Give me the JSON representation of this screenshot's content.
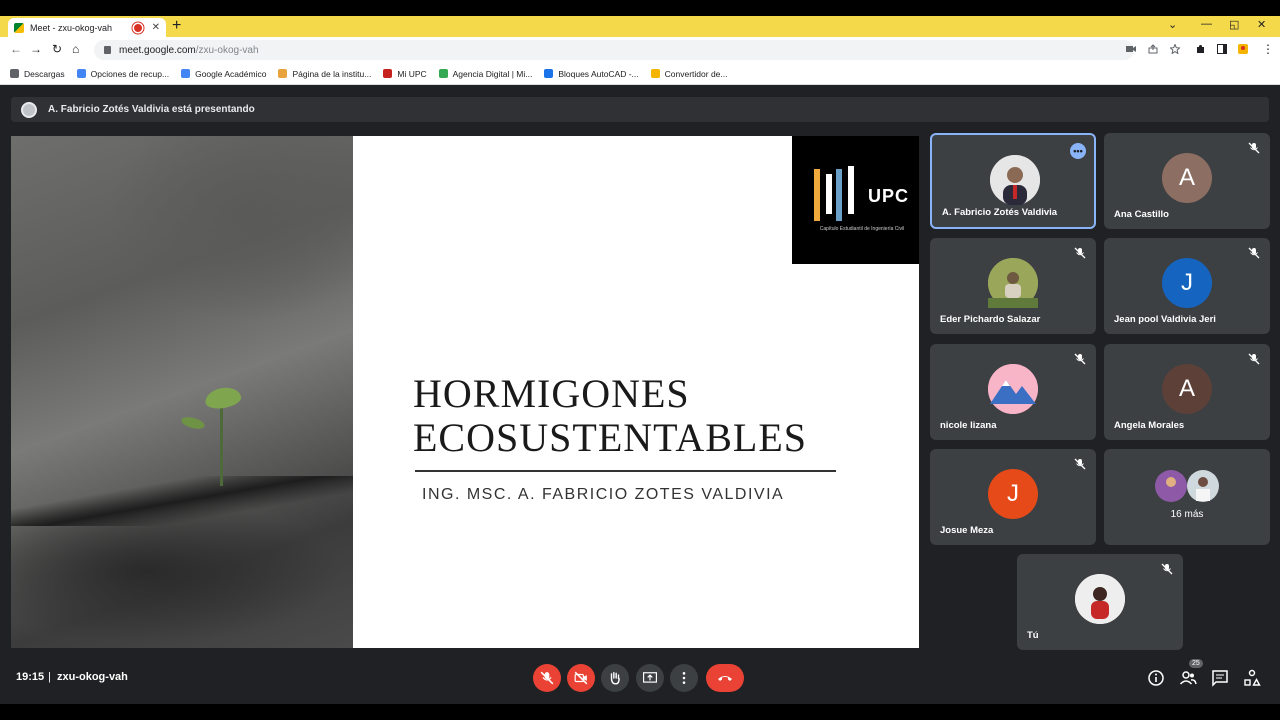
{
  "browser": {
    "tab_title": "Meet - zxu-okog-vah",
    "new_tab": "+",
    "url_host": "meet.google.com",
    "url_path": "/zxu-okog-vah",
    "bookmarks": [
      {
        "label": "Descargas",
        "icon": "download-icon",
        "color": "#5f6368"
      },
      {
        "label": "Opciones de recup...",
        "icon": "google-icon",
        "color": "#4285f4"
      },
      {
        "label": "Google Académico",
        "icon": "scholar-icon",
        "color": "#4285f4"
      },
      {
        "label": "Página de la institu...",
        "icon": "pencil-icon",
        "color": "#e8a33c"
      },
      {
        "label": "Mi UPC",
        "icon": "upc-icon",
        "color": "#c5221f"
      },
      {
        "label": "Agencia Digital | Mi...",
        "icon": "diamond-icon",
        "color": "#34a853"
      },
      {
        "label": "Bloques AutoCAD -...",
        "icon": "blocks-icon",
        "color": "#1a73e8"
      },
      {
        "label": "Convertidor de...",
        "icon": "check-icon",
        "color": "#f4b400"
      }
    ]
  },
  "presenting": {
    "text": "A. Fabricio Zotés Valdivia está presentando"
  },
  "slide": {
    "logo_text": "UPC",
    "logo_subtitle": "Capítulo Estudiantil de Ingeniería Civil",
    "title_line1": "HORMIGONES",
    "title_line2": "ECOSUSTENTABLES",
    "subtitle": "ING. MSC. A. FABRICIO ZOTES VALDIVIA"
  },
  "participants": [
    {
      "name": "A. Fabricio Zotés Valdivia",
      "initial": "",
      "color": "#d9d9d9",
      "active": true
    },
    {
      "name": "Ana Castillo",
      "initial": "A",
      "color": "#8d6e63",
      "muted": true
    },
    {
      "name": "Eder Pichardo Salazar",
      "initial": "",
      "color": "#9aa65a",
      "muted": true
    },
    {
      "name": "Jean pool Valdivia Jeri",
      "initial": "J",
      "color": "#1565c0",
      "muted": true
    },
    {
      "name": "nicole lizana",
      "initial": "",
      "color": "#f48fb1",
      "muted": true
    },
    {
      "name": "Angela Morales",
      "initial": "A",
      "color": "#5d4037",
      "muted": true
    },
    {
      "name": "Josue Meza",
      "initial": "J",
      "color": "#e64a19",
      "muted": true
    }
  ],
  "more": {
    "label": "16 más"
  },
  "self": {
    "name": "Tú"
  },
  "bottom": {
    "time": "19:15",
    "separator": "|",
    "meeting_code": "zxu-okog-vah",
    "people_count": "25"
  }
}
